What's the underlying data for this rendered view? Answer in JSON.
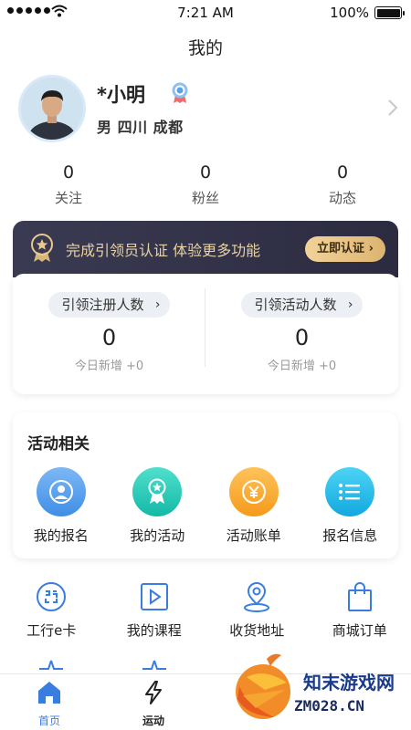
{
  "status_bar": {
    "time": "7:21 AM",
    "battery": "100%"
  },
  "header": {
    "title": "我的"
  },
  "profile": {
    "name": "*小明",
    "location": "男  四川 成都"
  },
  "stats": [
    {
      "value": "0",
      "label": "关注"
    },
    {
      "value": "0",
      "label": "粉丝"
    },
    {
      "value": "0",
      "label": "动态"
    }
  ],
  "cert_banner": {
    "text": "完成引领员认证 体验更多功能",
    "button": "立即认证 ›"
  },
  "guide": {
    "left": {
      "pill": "引领注册人数",
      "value": "0",
      "sub": "今日新增 +0"
    },
    "right": {
      "pill": "引领活动人数",
      "value": "0",
      "sub": "今日新增 +0"
    },
    "caret": "›"
  },
  "activity": {
    "title": "活动相关",
    "items": [
      {
        "label": "我的报名",
        "icon": "user-icon",
        "color": "#4a9cf0"
      },
      {
        "label": "我的活动",
        "icon": "medal-icon",
        "color": "#22c7b8"
      },
      {
        "label": "活动账单",
        "icon": "yen-icon",
        "color": "#f5a623"
      },
      {
        "label": "报名信息",
        "icon": "list-icon",
        "color": "#19b5e6"
      }
    ]
  },
  "tools": [
    {
      "label": "工行e卡",
      "icon": "card-icon"
    },
    {
      "label": "我的课程",
      "icon": "play-icon"
    },
    {
      "label": "收货地址",
      "icon": "location-icon"
    },
    {
      "label": "商城订单",
      "icon": "bag-icon"
    }
  ],
  "tabbar": {
    "home": {
      "label": "首页",
      "icon": "home-icon"
    },
    "sport": {
      "label": "运动",
      "icon": "lightning-icon"
    }
  },
  "watermark": {
    "text": "知末游戏网",
    "sub": "ZM028.CN"
  },
  "colors": {
    "primary": "#3a7de0",
    "gold": "#e9d3a6",
    "dark_banner": "#33324a"
  }
}
